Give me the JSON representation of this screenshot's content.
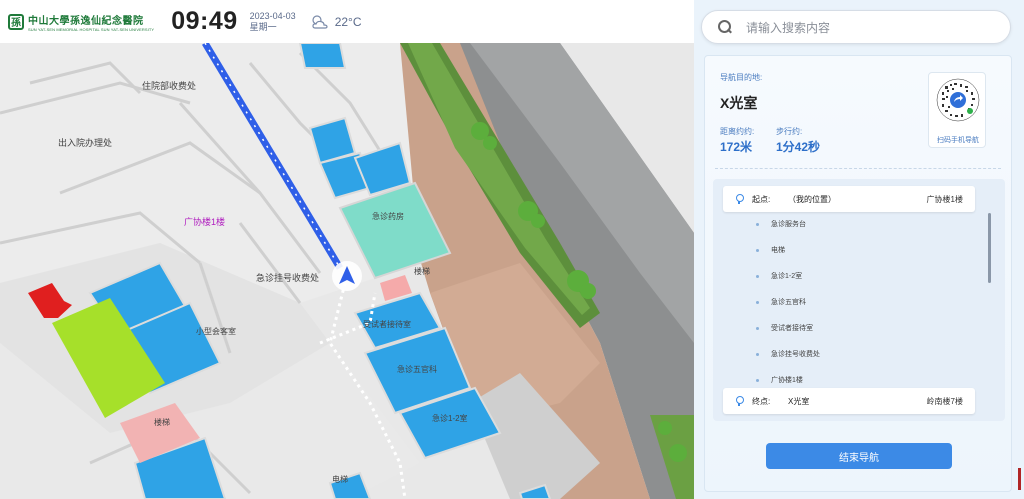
{
  "header": {
    "logo_cn": "中山大學孫逸仙紀念醫院",
    "logo_en": "SUN YAT-SEN MEMORIAL HOSPITAL SUN YAT-SEN UNIVERSITY",
    "time": "09:49",
    "date": "2023-04-03",
    "weekday": "星期一",
    "weather_icon": "partly-cloudy-icon",
    "temperature": "22°C"
  },
  "map": {
    "labels": {
      "inpatient_cashier": "住院部收费处",
      "admission_office": "出入院办理处",
      "guangxie_1f": "广协楼1楼",
      "er_pharmacy": "急诊药房",
      "er_registration": "急诊挂号收费处",
      "stairs_1": "楼梯",
      "stairs_2": "楼梯",
      "small_lounge": "小型会客室",
      "victim_reception": "受试者接待室",
      "er_surgery": "急诊五官科",
      "er_room_12": "急诊1-2室",
      "elevator": "电梯"
    },
    "icons": {
      "location_arrow": "navigation-arrow-icon"
    },
    "colors": {
      "room_blue": "#2fa3e6",
      "route_blue": "#2f5fe8",
      "pharmacy_teal": "#7fdcc9",
      "lime": "#a6e02a",
      "red": "#e01f1f",
      "pink": "#f2b3b3"
    }
  },
  "search": {
    "placeholder": "请输入搜索内容"
  },
  "nav": {
    "dest_label": "导航目的地:",
    "dest_name": "X光室",
    "distance_label": "距离约约:",
    "distance_value": "172米",
    "walk_label": "步行约:",
    "walk_value": "1分42秒",
    "qr_caption": "扫码手机导航",
    "start": {
      "key": "起点:",
      "value": "（我的位置）",
      "building": "广协楼1楼"
    },
    "steps": [
      "急诊服务台",
      "电梯",
      "急诊1-2室",
      "急诊五官科",
      "受试者接待室",
      "急诊挂号收费处",
      "广协楼1楼"
    ],
    "end": {
      "key": "终点:",
      "value": "X光室",
      "building": "岭南楼7楼"
    },
    "end_button": "结束导航"
  }
}
